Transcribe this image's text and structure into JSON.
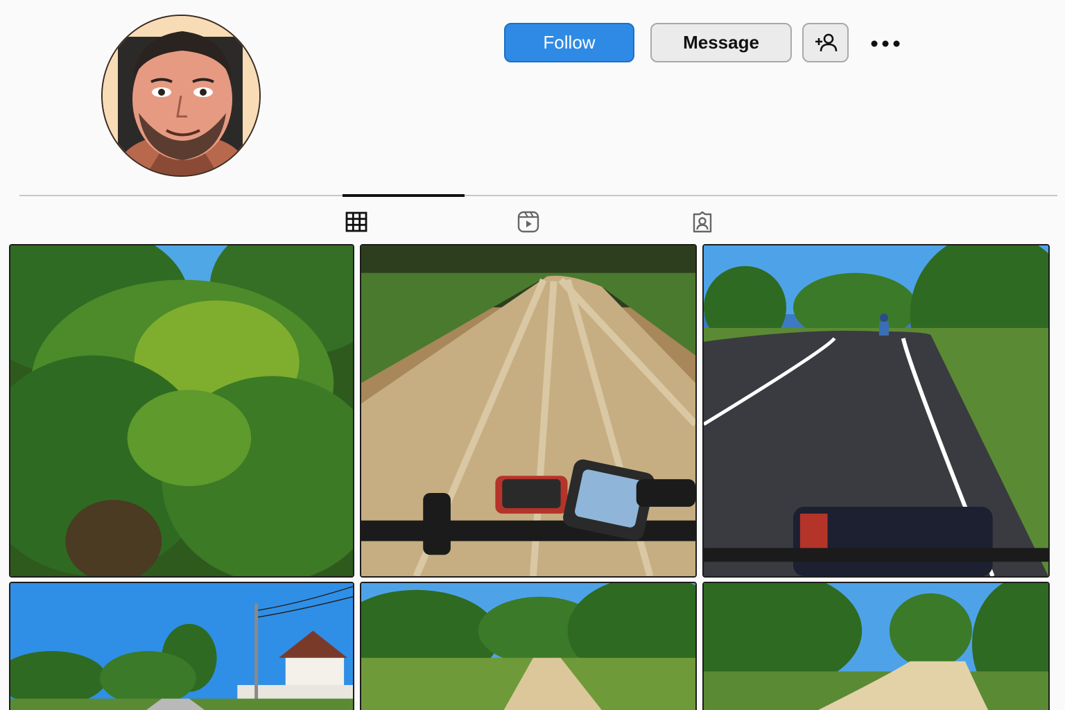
{
  "profile": {
    "avatar_icon": "profile-photo"
  },
  "actions": {
    "follow_label": "Follow",
    "message_label": "Message",
    "add_user_icon": "add-user-icon",
    "more_icon": "more-horizontal-icon"
  },
  "colors": {
    "follow_button": "#2f8ae6",
    "active_tab_underline": "#111111",
    "page_background": "#fafafa"
  },
  "tabs": [
    {
      "icon": "grid-icon",
      "active": true
    },
    {
      "icon": "reels-icon",
      "active": false
    },
    {
      "icon": "tagged-icon",
      "active": false
    }
  ],
  "posts": [
    {
      "icon": "photo-dense-green-bushes"
    },
    {
      "icon": "photo-gravel-road-handlebars"
    },
    {
      "icon": "photo-asphalt-road-cyclist"
    },
    {
      "icon": "photo-village-road-power-lines"
    },
    {
      "icon": "photo-dirt-path-grass"
    },
    {
      "icon": "photo-sandy-road-trees"
    }
  ]
}
